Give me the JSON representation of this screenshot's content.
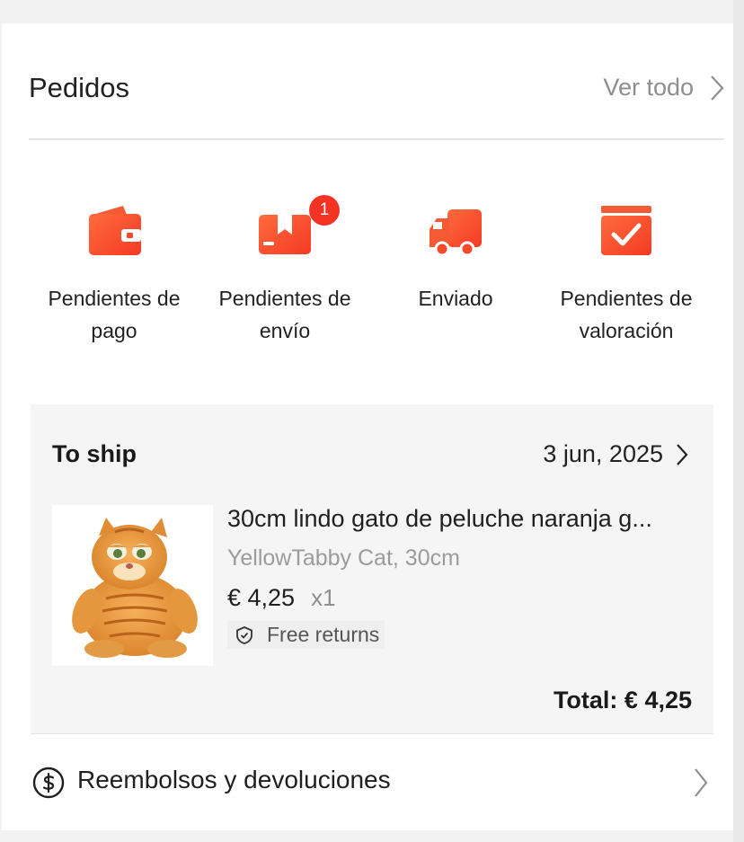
{
  "orders": {
    "title": "Pedidos",
    "see_all": "Ver todo",
    "statuses": [
      {
        "label": "Pendientes de\npago",
        "icon": "wallet-icon"
      },
      {
        "label": "Pendientes de\nenvío",
        "icon": "package-icon",
        "badge": "1"
      },
      {
        "label": "Enviado",
        "icon": "truck-icon"
      },
      {
        "label": "Pendientes de\nvaloración",
        "icon": "review-box-icon"
      }
    ]
  },
  "order_card": {
    "status": "To ship",
    "date": "3 jun, 2025",
    "product": {
      "name": "30cm lindo gato de peluche naranja g...",
      "variant": "YellowTabby Cat, 30cm",
      "price": "€ 4,25",
      "quantity": "x1",
      "returns": "Free returns"
    },
    "total": "Total: € 4,25"
  },
  "refunds": {
    "label": "Reembolsos y devoluciones",
    "icon": "dollar-circle-icon"
  },
  "colors": {
    "accent": "#f84c2a",
    "accent_light": "#ff6b3d",
    "badge": "#f43324",
    "muted": "#8e8e8e",
    "card_bg": "#f5f5f5"
  }
}
